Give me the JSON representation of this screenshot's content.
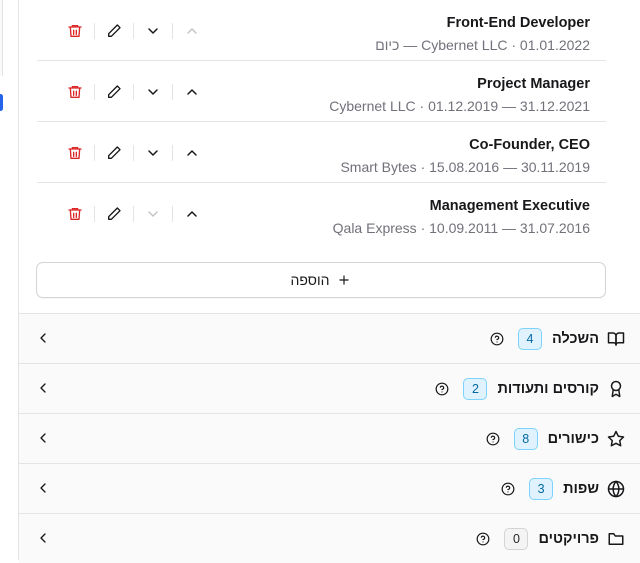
{
  "experience": [
    {
      "title": "Front-End Developer",
      "meta": "Cybernet LLC · 01.01.2022 — כיום",
      "can_move_up": false,
      "can_move_down": true
    },
    {
      "title": "Project Manager",
      "meta": "Cybernet LLC · 01.12.2019 — 31.12.2021",
      "can_move_up": true,
      "can_move_down": true
    },
    {
      "title": "Co-Founder, CEO",
      "meta": "Smart Bytes · 15.08.2016 — 30.11.2019",
      "can_move_up": true,
      "can_move_down": true
    },
    {
      "title": "Management Executive",
      "meta": "Qala Express · 10.09.2011 — 31.07.2016",
      "can_move_up": true,
      "can_move_down": false
    }
  ],
  "add_button_label": "הוספה",
  "sections": [
    {
      "title": "השכלה",
      "count": "4",
      "icon": "book-open-icon"
    },
    {
      "title": "קורסים ותעודות",
      "count": "2",
      "icon": "award-icon"
    },
    {
      "title": "כישורים",
      "count": "8",
      "icon": "star-icon"
    },
    {
      "title": "שפות",
      "count": "3",
      "icon": "globe-icon"
    },
    {
      "title": "פרויקטים",
      "count": "0",
      "icon": "folder-icon"
    }
  ],
  "colors": {
    "delete": "#dc2626",
    "count_badge_active": "#0369a1",
    "count_badge_empty": "#27272a",
    "accent": "#2563eb"
  }
}
